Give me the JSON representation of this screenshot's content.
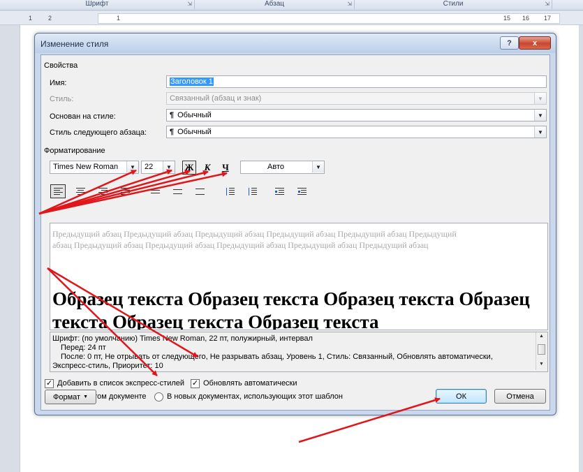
{
  "ribbon": {
    "groups": [
      "Шрифт",
      "Абзац",
      "Стили"
    ]
  },
  "ruler": {
    "marks": [
      "1",
      "2",
      "1",
      "15",
      "16",
      "17"
    ]
  },
  "dialog": {
    "title": "Изменение стиля",
    "help_label": "?",
    "close_label": "x",
    "properties": {
      "section_label": "Свойства",
      "name_label": "Имя:",
      "name_value": "Заголовок 1",
      "style_type_label": "Стиль:",
      "style_type_value": "Связанный (абзац и знак)",
      "based_on_label": "Основан на стиле:",
      "based_on_value": "Обычный",
      "next_style_label": "Стиль следующего абзаца:",
      "next_style_value": "Обычный"
    },
    "formatting": {
      "section_label": "Форматирование",
      "font": "Times New Roman",
      "size": "22",
      "bold": "Ж",
      "italic": "К",
      "underline": "Ч",
      "color": "Авто"
    },
    "preview": {
      "previous_paragraph": "Предыдущий абзац Предыдущий абзац Предыдущий абзац Предыдущий абзац Предыдущий абзац Предыдущий абзац Предыдущий абзац Предыдущий абзац Предыдущий абзац Предыдущий абзац Предыдущий абзац",
      "sample_text": "Образец текста Образец текста Образец текста Образец текста Образец текста Образец текста"
    },
    "description": {
      "line1": "Шрифт: (по умолчанию) Times New Roman, 22 пт, полужирный, интервал",
      "line2": "Перед:  24 пт",
      "line3": "После:  0 пт, Не отрывать от следующего, Не разрывать абзац, Уровень 1, Стиль: Связанный, Обновлять автоматически,",
      "line4": "Экспресс-стиль, Приоритет: 10"
    },
    "options": {
      "add_to_quick_styles": "Добавить в список экспресс-стилей",
      "auto_update": "Обновлять автоматически",
      "only_this_document": "Только в этом документе",
      "new_documents": "В новых документах, использующих этот шаблон"
    },
    "buttons": {
      "format": "Формат",
      "ok": "ОК",
      "cancel": "Отмена"
    }
  },
  "icons": {
    "paragraph_mark": "¶",
    "dropdown": "▼",
    "checkmark": "✓",
    "scroll_up": "▲",
    "scroll_down": "▼"
  },
  "colors": {
    "annotation_arrow": "#e0161a",
    "default_button": "#3c7fb1"
  }
}
